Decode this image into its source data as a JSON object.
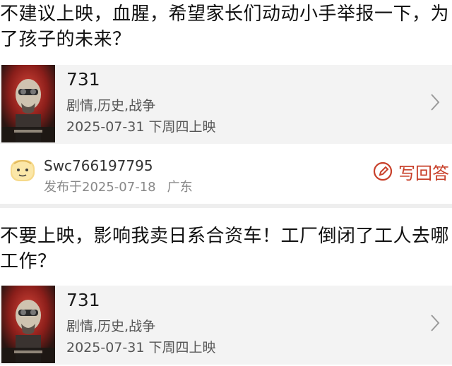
{
  "posts": [
    {
      "text": "不建议上映，血腥，希望家长们动动小手举报一下，为了孩子的未来？",
      "movie": {
        "title": "731",
        "genre": "剧情,历史,战争",
        "release": "2025-07-31 下周四上映"
      },
      "author": {
        "username": "Swc766197795",
        "published": "发布于2025-07-18",
        "region": "广东"
      },
      "reply_label": "写回答"
    },
    {
      "text": "不要上映，影响我卖日系合资车！工厂倒闭了工人去哪工作？",
      "movie": {
        "title": "731",
        "genre": "剧情,历史,战争",
        "release": "2025-07-31 下周四上映"
      }
    }
  ],
  "icons": {
    "chevron": "chevron-right-icon",
    "avatar": "cartoon-face-avatar",
    "reply": "edit-pencil-icon"
  },
  "colors": {
    "accent": "#c8402a",
    "card_bg": "#f3f3f3"
  }
}
